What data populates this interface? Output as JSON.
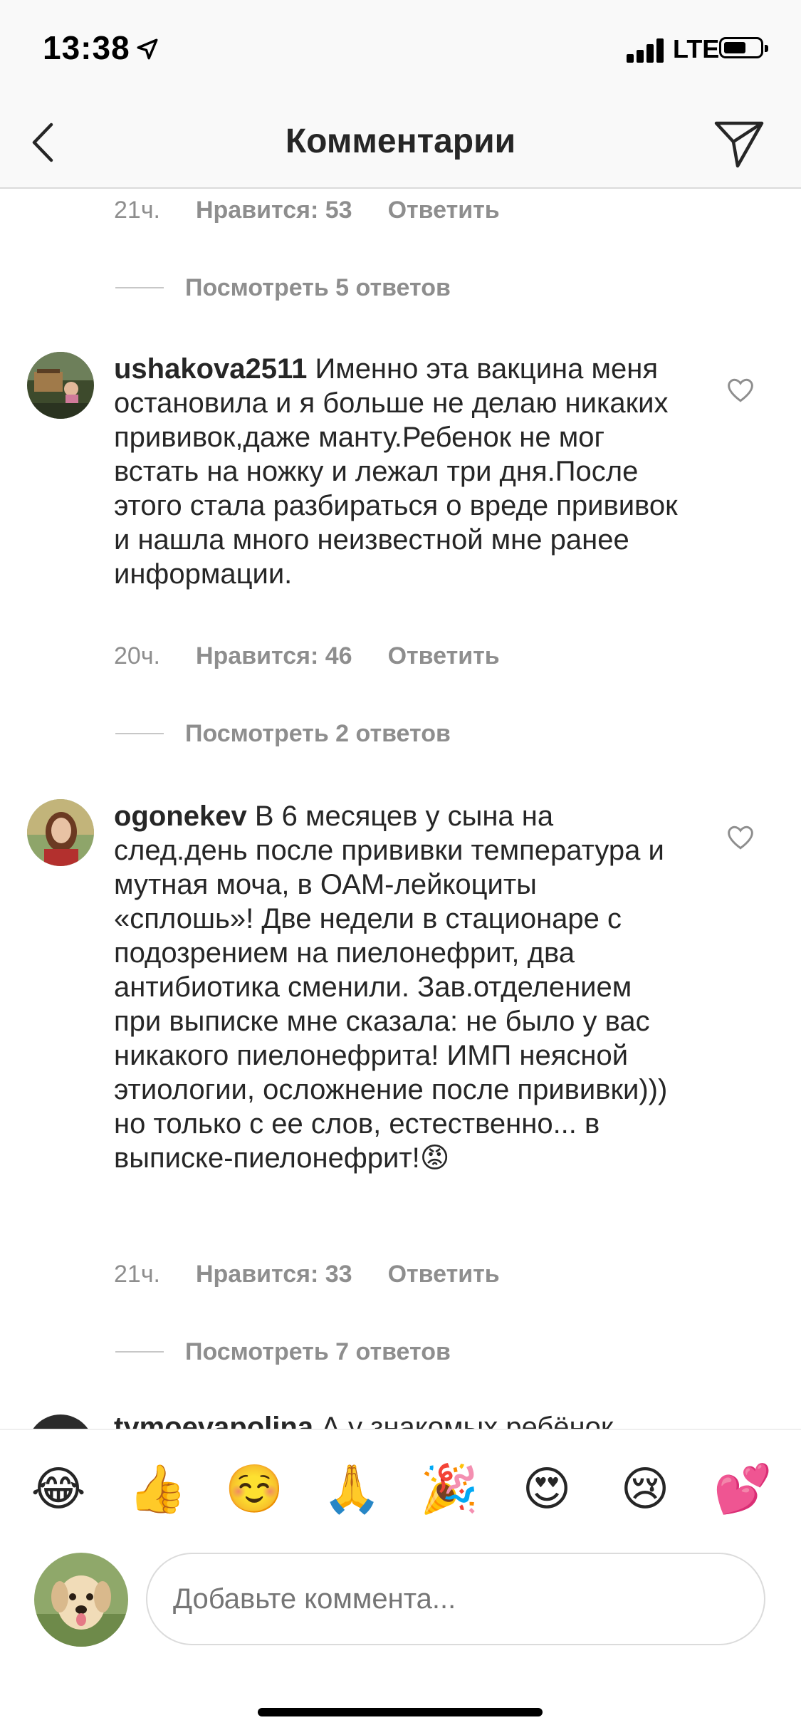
{
  "status_bar": {
    "time": "13:38",
    "network": "LTE",
    "location_icon": "location-arrow-icon"
  },
  "header": {
    "title": "Комментарии",
    "back_icon": "chevron-left-icon",
    "send_icon": "paper-plane-icon"
  },
  "top_meta": {
    "age": "21ч.",
    "likes": "Нравится: 53",
    "reply": "Ответить",
    "view_replies": "Посмотреть 5 ответов"
  },
  "comments": [
    {
      "username": "ushakova2511",
      "text": "Именно эта вакцина меня остановила и я больше не делаю никаких прививок,даже манту.Ребенок не мог встать на ножку и лежал три дня.После этого стала разбираться о вреде прививок и нашла много неизвестной мне ранее информации.",
      "age": "20ч.",
      "likes": "Нравится: 46",
      "reply": "Ответить",
      "view_replies": "Посмотреть 2 ответов"
    },
    {
      "username": "ogonekev",
      "text": "В 6 месяцев у сына на след.день после прививки температура и мутная моча, в ОАМ-лейкоциты «сплошь»! Две недели в стационаре с подозрением на пиелонефрит, два антибиотика сменили. Зав.отделением при выписке мне сказала: не было у вас никакого пиелонефрита! ИМП неясной этиологии, осложнение после прививки))) но только с ее слов, естественно... в выписке-пиелонефрит!😡",
      "age": "21ч.",
      "likes": "Нравится: 33",
      "reply": "Ответить",
      "view_replies": "Посмотреть 7 ответов"
    },
    {
      "username": "tymoevapolina",
      "text": "А у знакомых ребёнок"
    }
  ],
  "emoji_bar": [
    "😂",
    "👍",
    "☺️",
    "🙏",
    "🎉",
    "😍",
    "😢",
    "💕"
  ],
  "composer": {
    "placeholder": "Добавьте коммента..."
  }
}
